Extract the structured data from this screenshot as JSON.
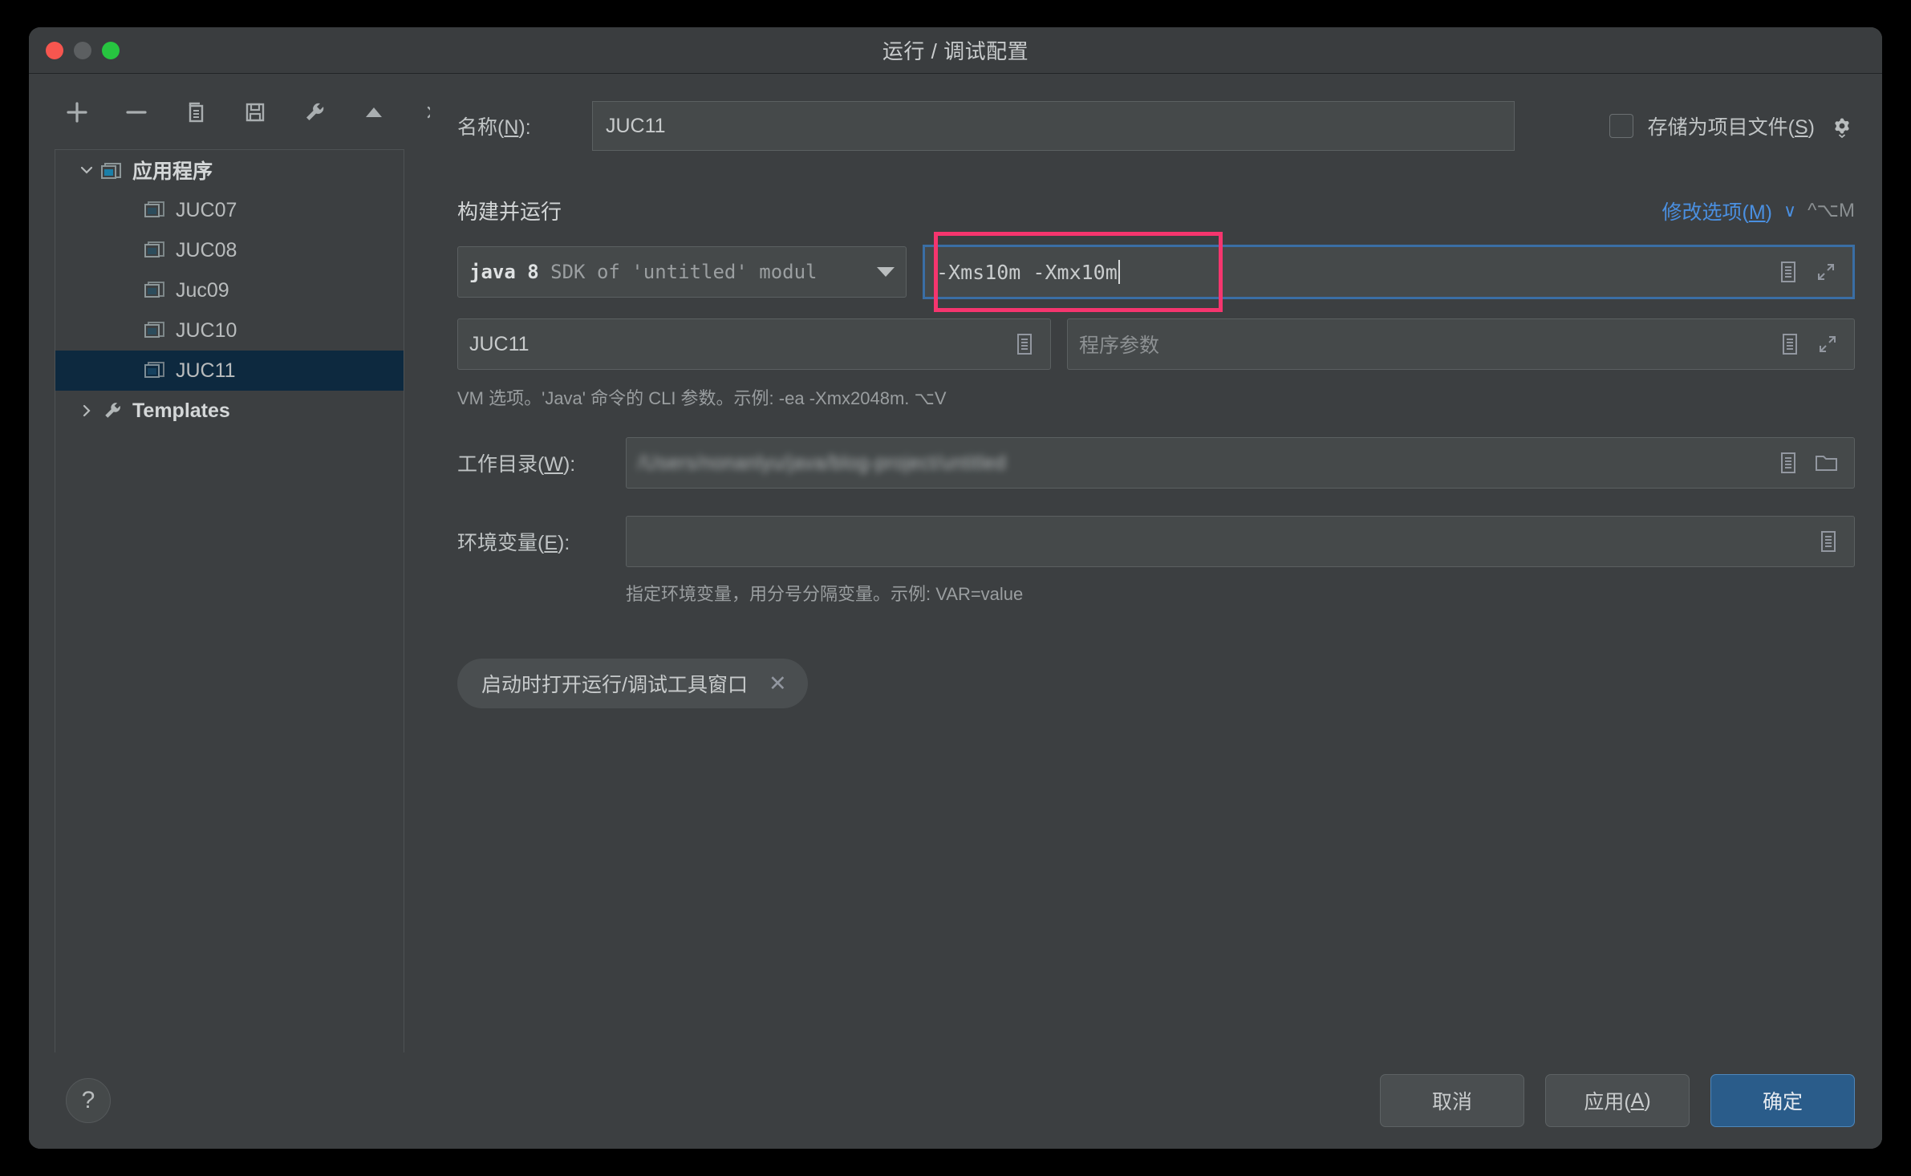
{
  "window": {
    "title": "运行 / 调试配置",
    "traffic_lights": [
      "close-red",
      "minimize-gray",
      "maximize-green"
    ]
  },
  "sidebar": {
    "toolbar_icons": [
      "add-icon",
      "remove-icon",
      "copy-icon",
      "save-icon",
      "wrench-icon",
      "move-up-icon",
      "more-icon"
    ],
    "tree": [
      {
        "label": "应用程序",
        "icon": "application-group-icon",
        "level": 0,
        "expanded": true,
        "selected": false,
        "bold": true
      },
      {
        "label": "JUC07",
        "icon": "application-icon",
        "level": 1,
        "selected": false
      },
      {
        "label": "JUC08",
        "icon": "application-icon",
        "level": 1,
        "selected": false
      },
      {
        "label": "Juc09",
        "icon": "application-icon",
        "level": 1,
        "selected": false
      },
      {
        "label": "JUC10",
        "icon": "application-icon",
        "level": 1,
        "selected": false
      },
      {
        "label": "JUC11",
        "icon": "application-icon",
        "level": 1,
        "selected": true
      },
      {
        "label": "Templates",
        "icon": "wrench-icon",
        "level": 0,
        "expanded": false,
        "selected": false,
        "bold": true
      }
    ]
  },
  "name_row": {
    "label": "名称(N):",
    "label_prefix": "名称(",
    "label_mnemonic": "N",
    "label_suffix": "):",
    "value": "JUC11",
    "store_as_project_file": {
      "label_prefix": "存储为项目文件(",
      "label_mnemonic": "S",
      "label_suffix": ")",
      "checked": false,
      "gear_icon": "gear-icon"
    }
  },
  "build_run": {
    "section_title": "构建并运行",
    "modify_options": {
      "label_prefix": "修改选项(",
      "label_mnemonic": "M",
      "label_suffix": ")",
      "chevron": "∨",
      "shortcut": "^⌥M",
      "color": "#4a8fe0"
    },
    "jdk": {
      "primary": "java 8",
      "secondary": " SDK of 'untitled' modul",
      "caret": "chevron-down-icon"
    },
    "vm_options": {
      "value": "-Xms10m -Xmx10m",
      "focused": true,
      "focus_color": "#3a6ea5",
      "highlight_color": "#f5356e",
      "expand_icon": "expand-icon",
      "macro_icon": "insert-macro-icon"
    },
    "main_class": {
      "value": "JUC11",
      "macro_icon": "insert-macro-icon"
    },
    "program_args": {
      "placeholder": "程序参数",
      "value": "",
      "macro_icon": "insert-macro-icon",
      "expand_icon": "expand-icon"
    },
    "vm_hint": "VM 选项。'Java' 命令的 CLI 参数。示例: -ea -Xmx2048m. ⌥V"
  },
  "working_dir": {
    "label_prefix": "工作目录(",
    "label_mnemonic": "W",
    "label_suffix": "):",
    "value": "/Users/nonanlyu/java/blog-project/untitled",
    "redacted": true,
    "macro_icon": "insert-macro-icon",
    "browse_icon": "folder-icon"
  },
  "env_vars": {
    "label_prefix": "环境变量(",
    "label_mnemonic": "E",
    "label_suffix": "):",
    "value": "",
    "macro_icon": "insert-macro-icon",
    "hint": "指定环境变量，用分号分隔变量。示例: VAR=value"
  },
  "chip": {
    "label": "启动时打开运行/调试工具窗口",
    "close_icon": "close-icon"
  },
  "footer": {
    "help_label": "?",
    "cancel": "取消",
    "apply_prefix": "应用(",
    "apply_mnemonic": "A",
    "apply_suffix": ")",
    "ok": "确定",
    "primary_color": "#2a5c8a"
  }
}
